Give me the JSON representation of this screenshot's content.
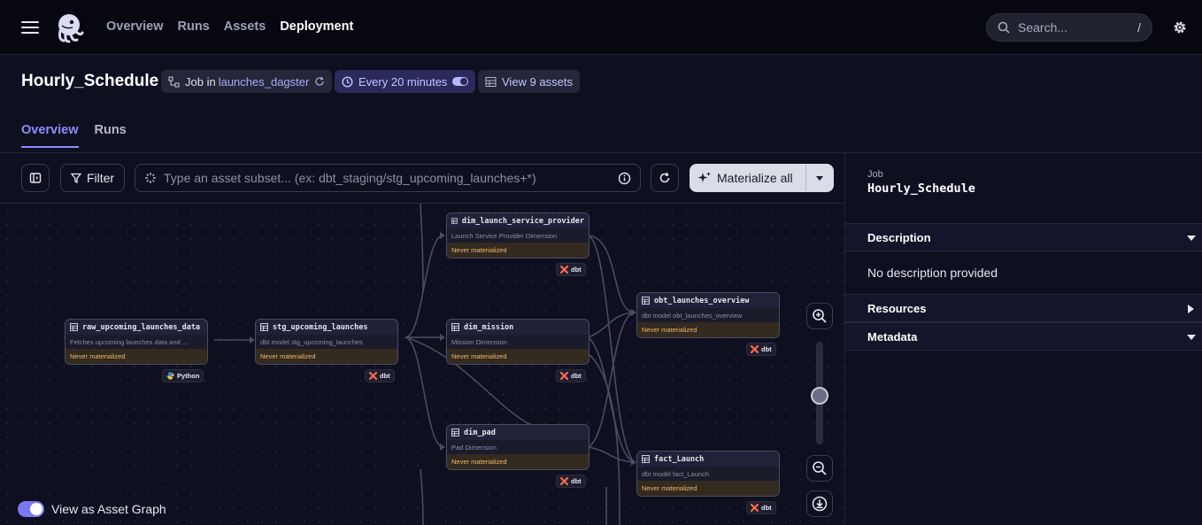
{
  "nav": {
    "links": [
      "Overview",
      "Runs",
      "Assets",
      "Deployment"
    ],
    "active": "Deployment",
    "search_placeholder": "Search...",
    "search_shortcut": "/"
  },
  "header": {
    "title": "Hourly_Schedule",
    "job_prefix": "Job in",
    "job_location": "launches_dagster",
    "schedule": "Every 20 minutes",
    "schedule_enabled": true,
    "view_assets": "View 9 assets"
  },
  "tabs": [
    "Overview",
    "Runs"
  ],
  "active_tab": "Overview",
  "toolbar": {
    "filter_label": "Filter",
    "query_placeholder": "Type an asset subset... (ex: dbt_staging/stg_upcoming_launches+*)",
    "materialize_label": "Materialize all"
  },
  "graph": {
    "nodes": [
      {
        "name": "raw_upcoming_launches_data",
        "description": "Fetches upcoming launches data and ...",
        "status": "Never materialized",
        "kind": "Python"
      },
      {
        "name": "stg_upcoming_launches",
        "description": "dbt model stg_upcoming_launches",
        "status": "Never materialized",
        "kind": "dbt"
      },
      {
        "name": "dim_launch_service_provider",
        "description": "Launch Service Provider Dimension",
        "status": "Never materialized",
        "kind": "dbt"
      },
      {
        "name": "dim_mission",
        "description": "Mission Dimension",
        "status": "Never materialized",
        "kind": "dbt"
      },
      {
        "name": "dim_pad",
        "description": "Pad Dimension",
        "status": "Never materialized",
        "kind": "dbt"
      },
      {
        "name": "obt_launches_overview",
        "description": "dbt model obt_launches_overview",
        "status": "Never materialized",
        "kind": "dbt"
      },
      {
        "name": "fact_Launch",
        "description": "dbt model fact_Launch",
        "status": "Never materialized",
        "kind": "dbt"
      }
    ],
    "view_as_asset_graph_label": "View as Asset Graph",
    "view_as_asset_graph_enabled": true
  },
  "panel": {
    "kind": "Job",
    "name": "Hourly_Schedule",
    "sections": [
      "Description",
      "Resources",
      "Metadata"
    ],
    "description_text": "No description provided"
  },
  "colors": {
    "accent": "#8e8cff",
    "status_never": "#f2b96a",
    "background": "#0e0f1f"
  }
}
